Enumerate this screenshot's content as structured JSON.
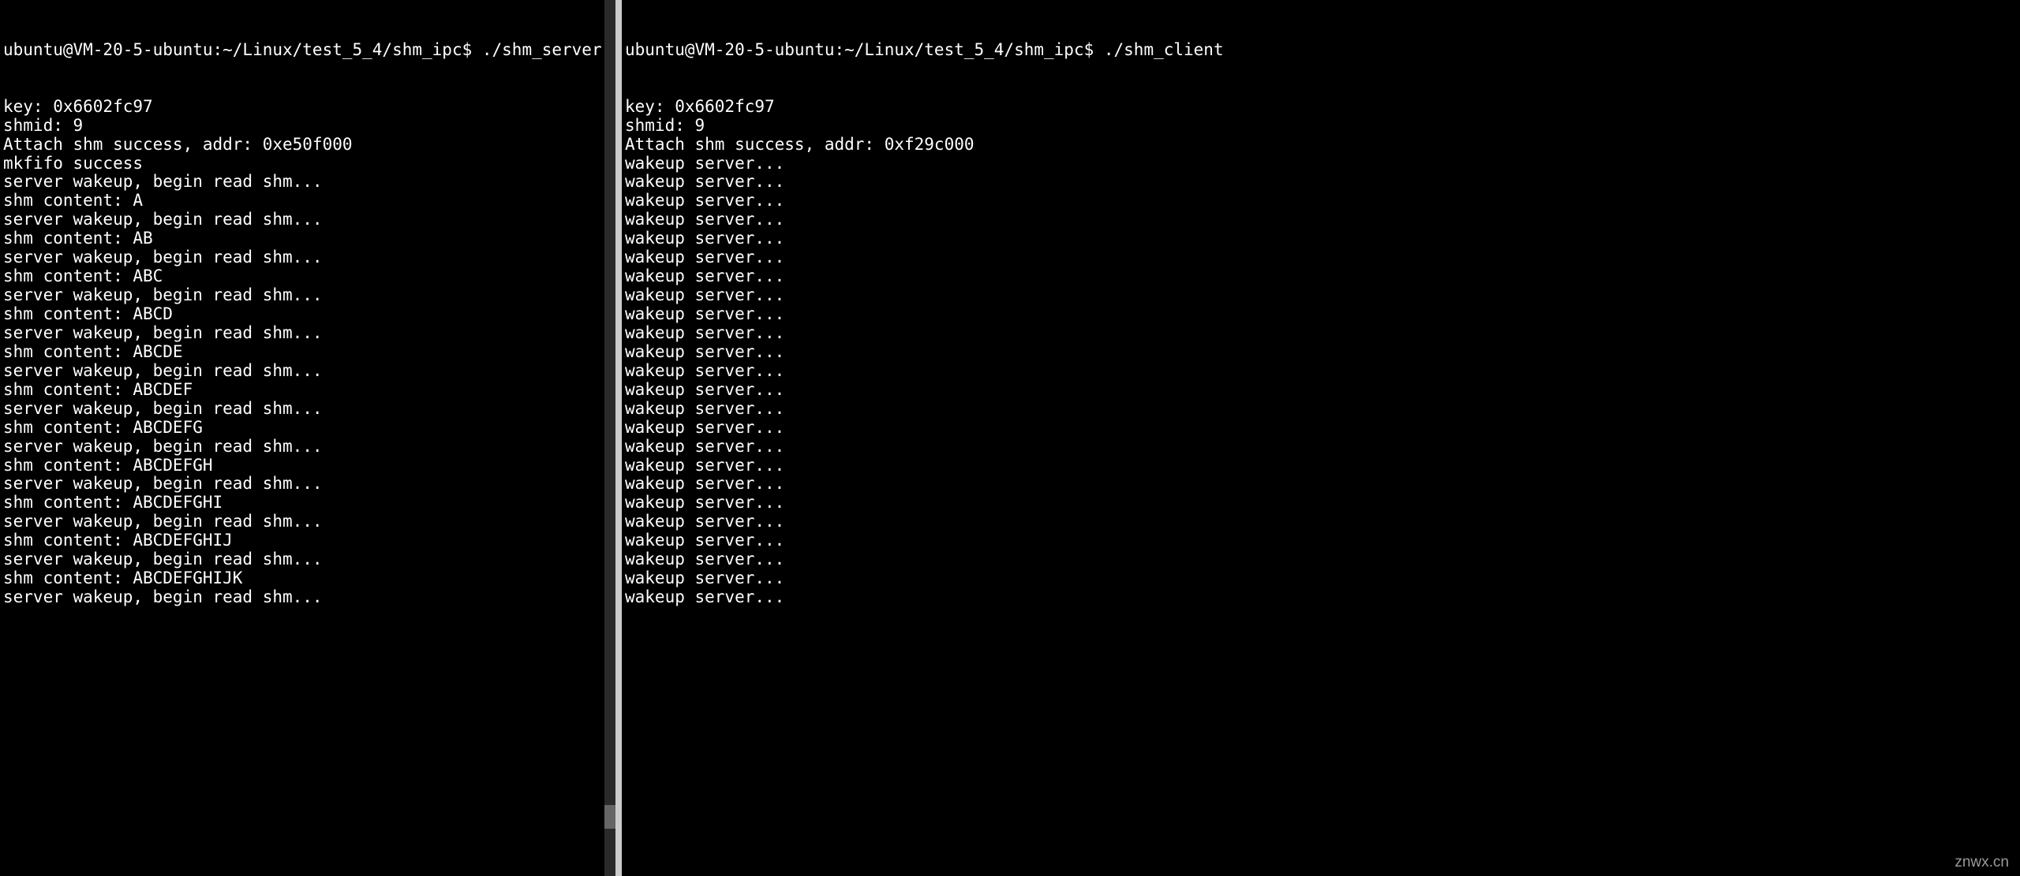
{
  "watermark": "znwx.cn",
  "left_terminal": {
    "prompt": "ubuntu@VM-20-5-ubuntu:~/Linux/test_5_4/shm_ipc$ ./shm_server",
    "lines": [
      "key: 0x6602fc97",
      "shmid: 9",
      "Attach shm success, addr: 0xe50f000",
      "mkfifo success",
      "server wakeup, begin read shm...",
      "shm content: A",
      "server wakeup, begin read shm...",
      "shm content: AB",
      "server wakeup, begin read shm...",
      "shm content: ABC",
      "server wakeup, begin read shm...",
      "shm content: ABCD",
      "server wakeup, begin read shm...",
      "shm content: ABCDE",
      "server wakeup, begin read shm...",
      "shm content: ABCDEF",
      "server wakeup, begin read shm...",
      "shm content: ABCDEFG",
      "server wakeup, begin read shm...",
      "shm content: ABCDEFGH",
      "server wakeup, begin read shm...",
      "shm content: ABCDEFGHI",
      "server wakeup, begin read shm...",
      "shm content: ABCDEFGHIJ",
      "server wakeup, begin read shm...",
      "shm content: ABCDEFGHIJK",
      "server wakeup, begin read shm..."
    ]
  },
  "right_terminal": {
    "prompt": "ubuntu@VM-20-5-ubuntu:~/Linux/test_5_4/shm_ipc$ ./shm_client",
    "lines": [
      "key: 0x6602fc97",
      "shmid: 9",
      "Attach shm success, addr: 0xf29c000",
      "wakeup server...",
      "wakeup server...",
      "wakeup server...",
      "wakeup server...",
      "wakeup server...",
      "wakeup server...",
      "wakeup server...",
      "wakeup server...",
      "wakeup server...",
      "wakeup server...",
      "wakeup server...",
      "wakeup server...",
      "wakeup server...",
      "wakeup server...",
      "wakeup server...",
      "wakeup server...",
      "wakeup server...",
      "wakeup server...",
      "wakeup server...",
      "wakeup server...",
      "wakeup server...",
      "wakeup server...",
      "wakeup server...",
      "wakeup server..."
    ]
  }
}
